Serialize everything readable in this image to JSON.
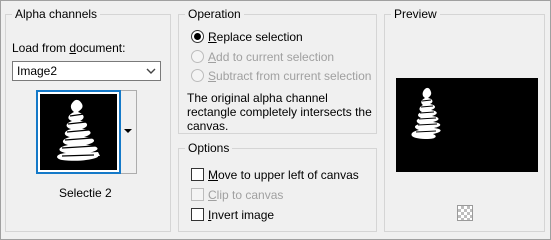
{
  "alpha": {
    "group_label": "Alpha channels",
    "load_label_pre": "Load from ",
    "load_label_key": "d",
    "load_label_post": "ocument:",
    "document_value": "Image2",
    "thumbnail_caption": "Selectie 2"
  },
  "operation": {
    "group_label": "Operation",
    "replace": {
      "key": "R",
      "rest": "eplace selection",
      "selected": true,
      "enabled": true
    },
    "add": {
      "key": "A",
      "rest": "dd to current selection",
      "selected": false,
      "enabled": false
    },
    "subtract": {
      "key": "S",
      "rest": "ubtract from current selection",
      "selected": false,
      "enabled": false
    },
    "info_line1": "The original alpha channel",
    "info_line2": "rectangle completely intersects the",
    "info_line3": "canvas."
  },
  "options": {
    "group_label": "Options",
    "move": {
      "key": "M",
      "rest": "ove to upper left of canvas",
      "checked": false,
      "enabled": true
    },
    "clip": {
      "key": "C",
      "rest": "lip to canvas",
      "checked": false,
      "enabled": false
    },
    "invert": {
      "key": "I",
      "rest": "nvert image",
      "checked": false,
      "enabled": true
    }
  },
  "preview": {
    "group_label": "Preview"
  },
  "colors": {
    "accent": "#1479c8",
    "disabled_text": "#a0a0a0"
  }
}
